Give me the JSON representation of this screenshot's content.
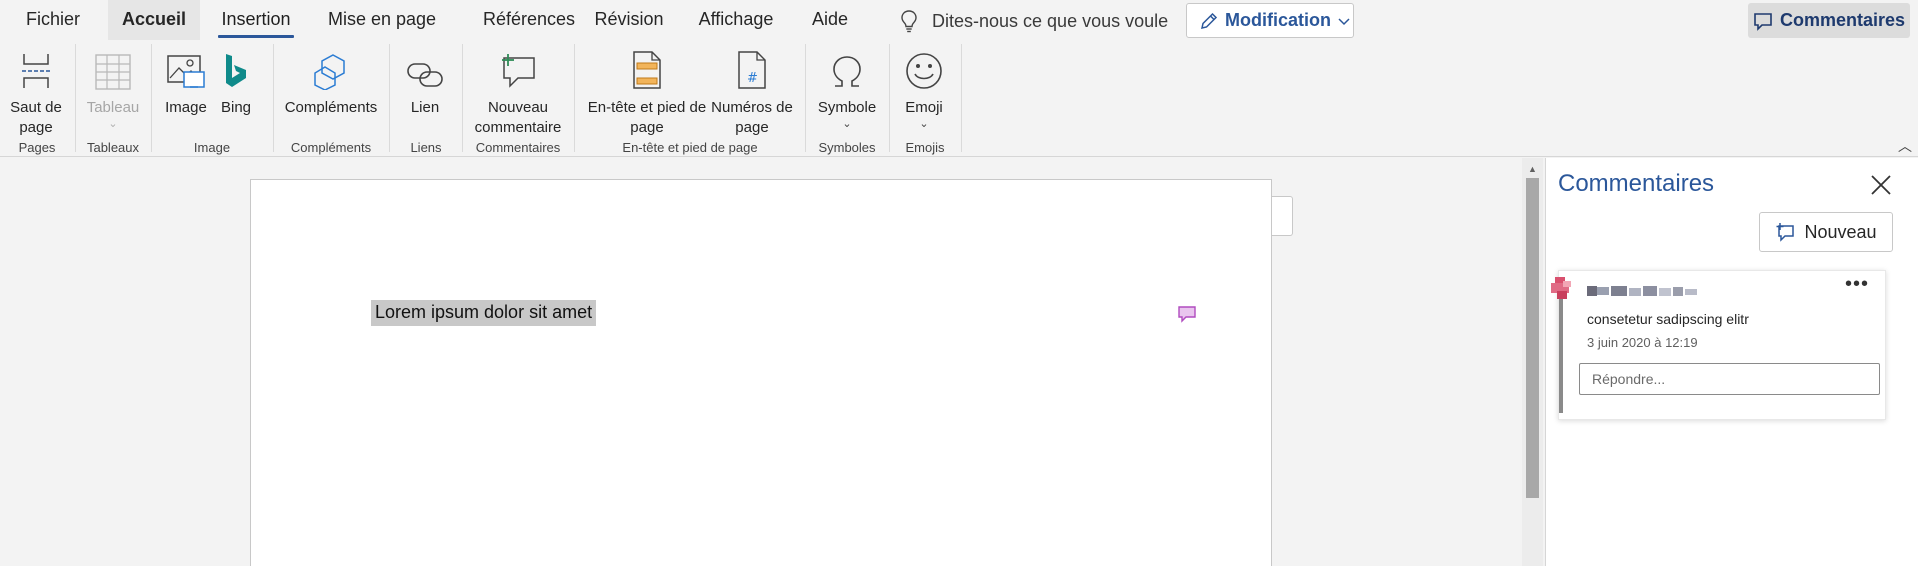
{
  "menubar": {
    "tabs": [
      {
        "label": "Fichier"
      },
      {
        "label": "Accueil"
      },
      {
        "label": "Insertion"
      },
      {
        "label": "Mise en page"
      },
      {
        "label": "Références"
      },
      {
        "label": "Révision"
      },
      {
        "label": "Affichage"
      },
      {
        "label": "Aide"
      }
    ],
    "tell_me": "Dites-nous ce que vous voule",
    "editing_mode": "Modification",
    "comments_button": "Commentaires"
  },
  "ribbon": {
    "buttons": {
      "saut_de_page": "Saut de\npage",
      "tableau": "Tableau",
      "image": "Image",
      "bing": "Bing",
      "complements": "Compléments",
      "lien": "Lien",
      "nouveau_commentaire": "Nouveau\ncommentaire",
      "entete": "En-tête et pied de\npage",
      "numeros": "Numéros de\npage",
      "symbole": "Symbole",
      "emoji": "Emoji"
    },
    "groups": {
      "pages": "Pages",
      "tableaux": "Tableaux",
      "image": "Image",
      "complements": "Compléments",
      "liens": "Liens",
      "commentaires": "Commentaires",
      "entete": "En-tête et pied de page",
      "symboles": "Symboles",
      "emojis": "Emojis"
    }
  },
  "document": {
    "selected_text": "Lorem ipsum dolor sit amet"
  },
  "comments_pane": {
    "title": "Commentaires",
    "new_button": "Nouveau",
    "comment": {
      "text": "consetetur sadipscing elitr",
      "date": "3 juin 2020 à 12:19",
      "reply_placeholder": "Répondre..."
    }
  },
  "colors": {
    "accent": "#2b579a",
    "bing": "#0f8a8a",
    "highlight": "#c8c8c8",
    "comment_marker": "#b04bbf"
  }
}
